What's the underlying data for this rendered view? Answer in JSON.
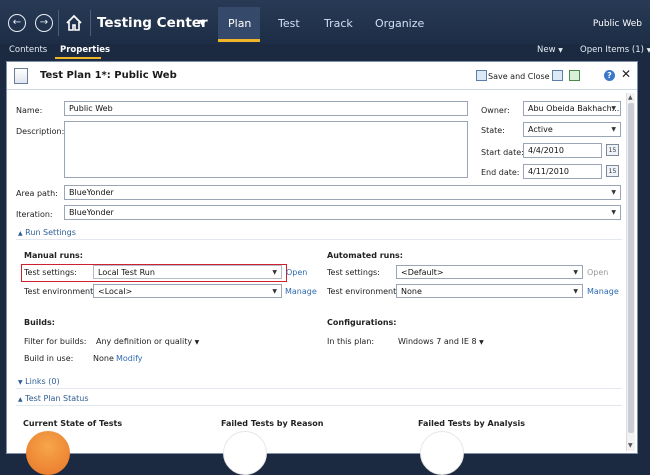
{
  "app": {
    "title": "Testing Center",
    "tabs": [
      {
        "label": "Plan",
        "active": true
      },
      {
        "label": "Test"
      },
      {
        "label": "Track"
      },
      {
        "label": "Organize"
      }
    ],
    "project": "Public Web",
    "accent_color": "#f0b429"
  },
  "subnav": {
    "contents": "Contents",
    "properties": "Properties",
    "new_label": "New",
    "open_items": "Open Items (1)"
  },
  "document": {
    "title": "Test Plan 1*: Public Web",
    "save_close": "Save and Close"
  },
  "form": {
    "name_label": "Name:",
    "name_value": "Public Web",
    "description_label": "Description:",
    "description_value": "",
    "owner_label": "Owner:",
    "owner_value": "Abu Obeida Bakhach...",
    "state_label": "State:",
    "state_value": "Active",
    "start_label": "Start date:",
    "start_value": "4/4/2010",
    "end_label": "End date:",
    "end_value": "4/11/2010",
    "calendar_day": "15",
    "area_label": "Area path:",
    "area_value": "BlueYonder",
    "iteration_label": "Iteration:",
    "iteration_value": "BlueYonder"
  },
  "run_settings": {
    "header": "Run Settings",
    "manual_header": "Manual runs:",
    "manual_test_settings_label": "Test settings:",
    "manual_test_settings_value": "Local Test Run",
    "manual_open": "Open",
    "manual_env_label": "Test environment:",
    "manual_env_value": "<Local>",
    "manual_manage": "Manage",
    "auto_header": "Automated runs:",
    "auto_test_settings_label": "Test settings:",
    "auto_test_settings_value": "<Default>",
    "auto_open": "Open",
    "auto_env_label": "Test environment:",
    "auto_env_value": "None",
    "auto_manage": "Manage"
  },
  "builds": {
    "header": "Builds:",
    "filter_label": "Filter for builds:",
    "filter_value": "Any definition or quality",
    "inuse_label": "Build in use:",
    "inuse_value": "None",
    "modify": "Modify"
  },
  "configurations": {
    "header": "Configurations:",
    "inplan_label": "In this plan:",
    "inplan_value": "Windows 7 and IE 8"
  },
  "links_header": "Links (0)",
  "status": {
    "header": "Test Plan Status",
    "current_state": "Current State of Tests",
    "failed_by_reason": "Failed Tests by Reason",
    "failed_by_analysis": "Failed Tests by Analysis"
  }
}
